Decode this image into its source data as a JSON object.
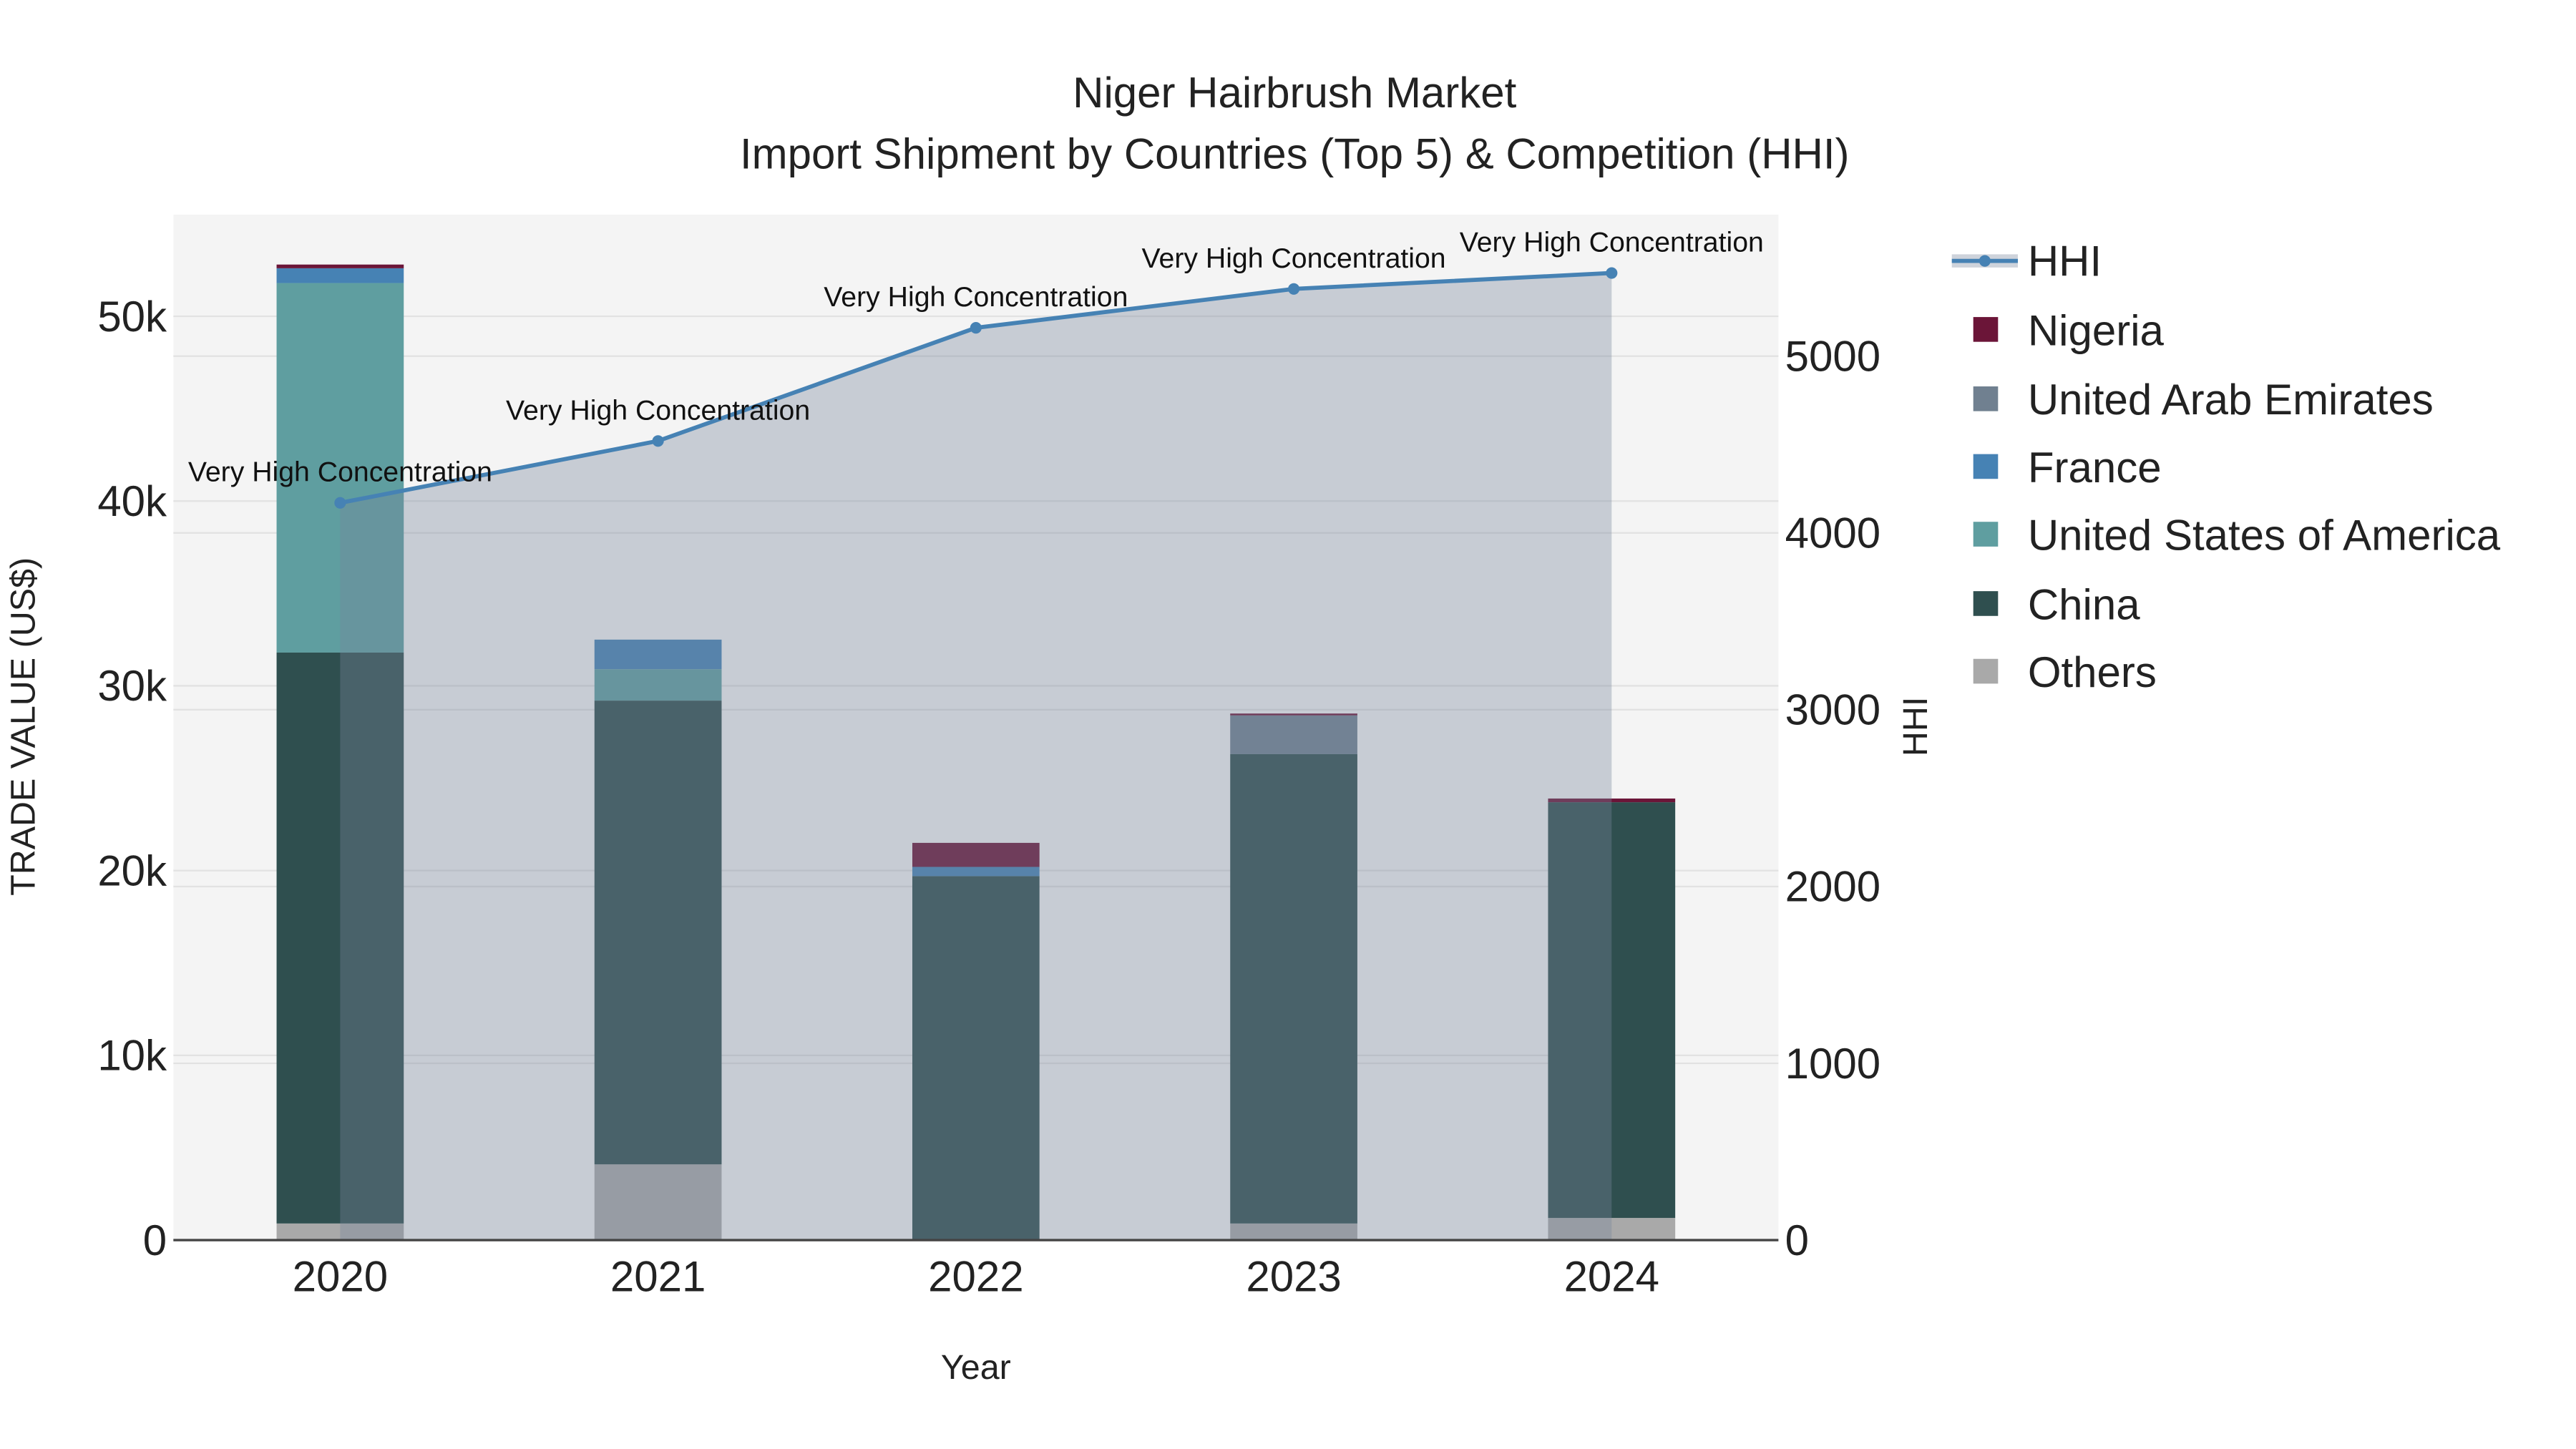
{
  "chart_data": {
    "type": "bar",
    "title": "Niger Hairbrush Market",
    "subtitle": "Import Shipment by Countries (Top 5) & Competition (HHI)",
    "xlabel": "Year",
    "ylabel": "TRADE VALUE (US$)",
    "y2label": "HHI",
    "categories": [
      "2020",
      "2021",
      "2022",
      "2023",
      "2024"
    ],
    "ylim": [
      0,
      55500
    ],
    "y2lim": [
      0,
      5800
    ],
    "yticks": [
      0,
      10000,
      20000,
      30000,
      40000,
      50000
    ],
    "ytick_labels": [
      "0",
      "10k",
      "20k",
      "30k",
      "40k",
      "50k"
    ],
    "y2ticks": [
      0,
      1000,
      2000,
      3000,
      4000,
      5000
    ],
    "y2tick_labels": [
      "0",
      "1000",
      "2000",
      "3000",
      "4000",
      "5000"
    ],
    "stacked": true,
    "series": [
      {
        "name": "Others",
        "color": "#A9A9A9",
        "values": [
          900,
          4100,
          0,
          900,
          1200
        ]
      },
      {
        "name": "China",
        "color": "#2F4F4F",
        "values": [
          30900,
          25100,
          19700,
          25400,
          22500
        ]
      },
      {
        "name": "United States of America",
        "color": "#5F9EA0",
        "values": [
          20000,
          1700,
          0,
          0,
          0
        ]
      },
      {
        "name": "France",
        "color": "#4682B4",
        "values": [
          800,
          1600,
          500,
          0,
          0
        ]
      },
      {
        "name": "United Arab Emirates",
        "color": "#708090",
        "values": [
          0,
          0,
          0,
          2100,
          0
        ]
      },
      {
        "name": "Nigeria",
        "color": "#6B1538",
        "values": [
          200,
          0,
          1300,
          100,
          200
        ]
      }
    ],
    "line": {
      "name": "HHI",
      "color": "#4682B4",
      "axis": "right",
      "values": [
        4170,
        4520,
        5160,
        5380,
        5470
      ],
      "annotations": [
        "Very High Concentration",
        "Very High Concentration",
        "Very High Concentration",
        "Very High Concentration",
        "Very High Concentration"
      ]
    },
    "legend": {
      "placement": "right",
      "entries": [
        "HHI",
        "Nigeria",
        "United Arab Emirates",
        "France",
        "United States of America",
        "China",
        "Others"
      ]
    },
    "grid": true
  }
}
